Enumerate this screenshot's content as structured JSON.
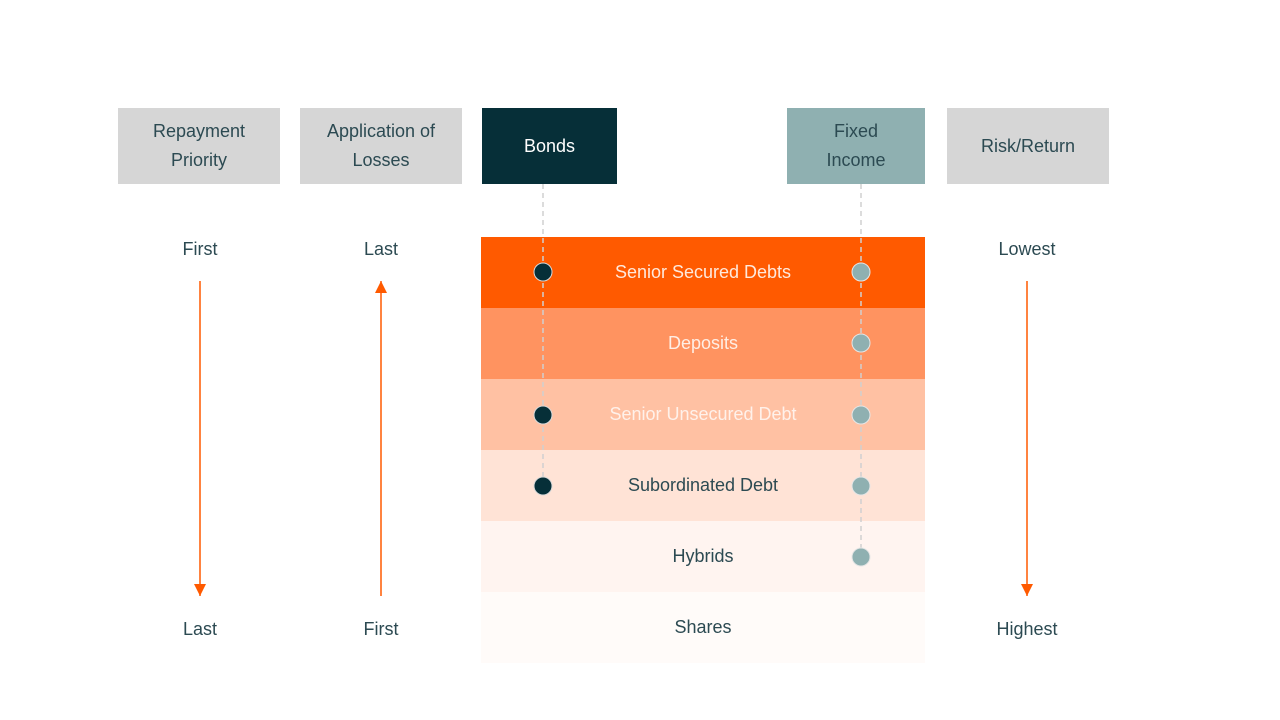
{
  "headers": {
    "repayment_priority": "Repayment\nPriority",
    "application_of_losses": "Application of\nLosses",
    "bonds": "Bonds",
    "fixed_income": "Fixed\nIncome",
    "risk_return": "Risk/Return"
  },
  "axes": {
    "repayment_priority": {
      "top": "First",
      "bottom": "Last",
      "arrow_direction": "down"
    },
    "application_of_losses": {
      "top": "Last",
      "bottom": "First",
      "arrow_direction": "up"
    },
    "risk_return": {
      "top": "Lowest",
      "bottom": "Highest",
      "arrow_direction": "down"
    }
  },
  "tiers": [
    {
      "label": "Senior Secured Debts",
      "bg": "#ff5a00",
      "text_color": "#ffe9dc",
      "bonds": true,
      "fixed_income": true
    },
    {
      "label": "Deposits",
      "bg": "#ff9360",
      "text_color": "#ffeee4",
      "bonds": false,
      "fixed_income": true
    },
    {
      "label": "Senior Unsecured Debt",
      "bg": "#ffc1a3",
      "text_color": "#fff1ea",
      "bonds": true,
      "fixed_income": true
    },
    {
      "label": "Subordinated Debt",
      "bg": "#ffe3d6",
      "text_color": "#2c4a52",
      "bonds": true,
      "fixed_income": true
    },
    {
      "label": "Hybrids",
      "bg": "#fff4f0",
      "text_color": "#2c4a52",
      "bonds": false,
      "fixed_income": true
    },
    {
      "label": "Shares",
      "bg": "#fffbf9",
      "text_color": "#2c4a52",
      "bonds": false,
      "fixed_income": false
    }
  ],
  "colors": {
    "arrow": "#ff5a00",
    "bonds_dot": "#062f38",
    "fixed_income_dot": "#8fb0b1",
    "dashed_line": "#d0d0d0"
  }
}
